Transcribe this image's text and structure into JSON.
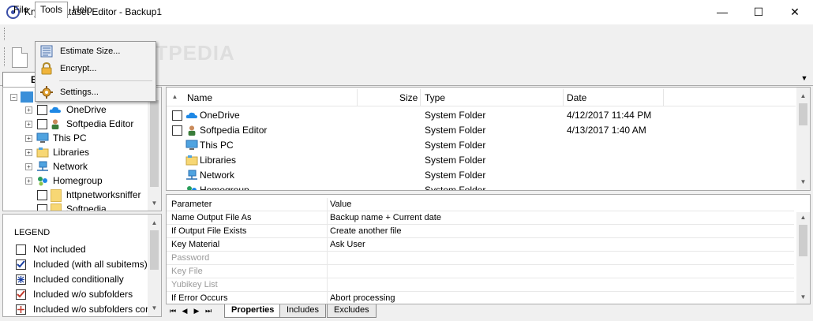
{
  "window": {
    "title": "Kryptel Dataset Editor - Backup1",
    "minimize_glyph": "—",
    "maximize_glyph": "☐",
    "close_glyph": "✕"
  },
  "menubar": {
    "items": [
      "File",
      "Tools",
      "Help"
    ]
  },
  "tools_menu": {
    "items": [
      {
        "label": "Estimate Size...",
        "icon": "estimate-icon"
      },
      {
        "label": "Encrypt...",
        "icon": "lock-icon"
      },
      {
        "label": "Settings...",
        "icon": "settings-gear-icon"
      }
    ]
  },
  "watermark": "SOFTPEDIA",
  "tabs": {
    "main_tab": "B"
  },
  "tree": {
    "items": [
      {
        "label": "OneDrive",
        "icon": "cloud-icon",
        "checkbox": true
      },
      {
        "label": "Softpedia Editor",
        "icon": "user-icon",
        "checkbox": true
      },
      {
        "label": "This PC",
        "icon": "computer-icon",
        "checkbox": false
      },
      {
        "label": "Libraries",
        "icon": "libraries-icon",
        "checkbox": false
      },
      {
        "label": "Network",
        "icon": "network-icon",
        "checkbox": false
      },
      {
        "label": "Homegroup",
        "icon": "homegroup-icon",
        "checkbox": false
      },
      {
        "label": "httpnetworksniffer",
        "icon": "folder-icon",
        "checkbox": true
      },
      {
        "label": "Softpedia",
        "icon": "folder-icon",
        "checkbox": true
      }
    ]
  },
  "legend": {
    "title": "LEGEND",
    "items": [
      "Not included",
      "Included (with all subitems)",
      "Included conditionally",
      "Included w/o subfolders",
      "Included w/o subfolders cor"
    ]
  },
  "file_list": {
    "columns": [
      "Name",
      "Size",
      "Type",
      "Date"
    ],
    "rows": [
      {
        "name": "OneDrive",
        "size": "",
        "type": "System Folder",
        "date": "4/12/2017 11:44 PM",
        "checkbox": true,
        "icon": "cloud-icon"
      },
      {
        "name": "Softpedia Editor",
        "size": "",
        "type": "System Folder",
        "date": "4/13/2017 1:40 AM",
        "checkbox": true,
        "icon": "user-icon"
      },
      {
        "name": "This PC",
        "size": "",
        "type": "System Folder",
        "date": "",
        "checkbox": false,
        "icon": "computer-icon"
      },
      {
        "name": "Libraries",
        "size": "",
        "type": "System Folder",
        "date": "",
        "checkbox": false,
        "icon": "libraries-icon"
      },
      {
        "name": "Network",
        "size": "",
        "type": "System Folder",
        "date": "",
        "checkbox": false,
        "icon": "network-icon"
      },
      {
        "name": "Homegroup",
        "size": "",
        "type": "System Folder",
        "date": "",
        "checkbox": false,
        "icon": "homegroup-icon"
      }
    ]
  },
  "properties": {
    "columns": [
      "Parameter",
      "Value"
    ],
    "rows": [
      {
        "parameter": "Name Output File As",
        "value": "Backup name + Current date",
        "enabled": true
      },
      {
        "parameter": "If Output File Exists",
        "value": "Create another file",
        "enabled": true
      },
      {
        "parameter": "Key Material",
        "value": "Ask User",
        "enabled": true
      },
      {
        "parameter": "Password",
        "value": "",
        "enabled": false
      },
      {
        "parameter": "Key File",
        "value": "",
        "enabled": false
      },
      {
        "parameter": "Yubikey List",
        "value": "",
        "enabled": false
      },
      {
        "parameter": "If Error Occurs",
        "value": "Abort processing",
        "enabled": true
      }
    ]
  },
  "bottom_tabs": [
    "Properties",
    "Includes",
    "Excludes"
  ],
  "colors": {
    "accent_blue": "#3b4fa8",
    "folder_yellow": "#f7d774",
    "cloud_blue": "#1e88e5",
    "checkbox_check": "#1a3fa0"
  }
}
